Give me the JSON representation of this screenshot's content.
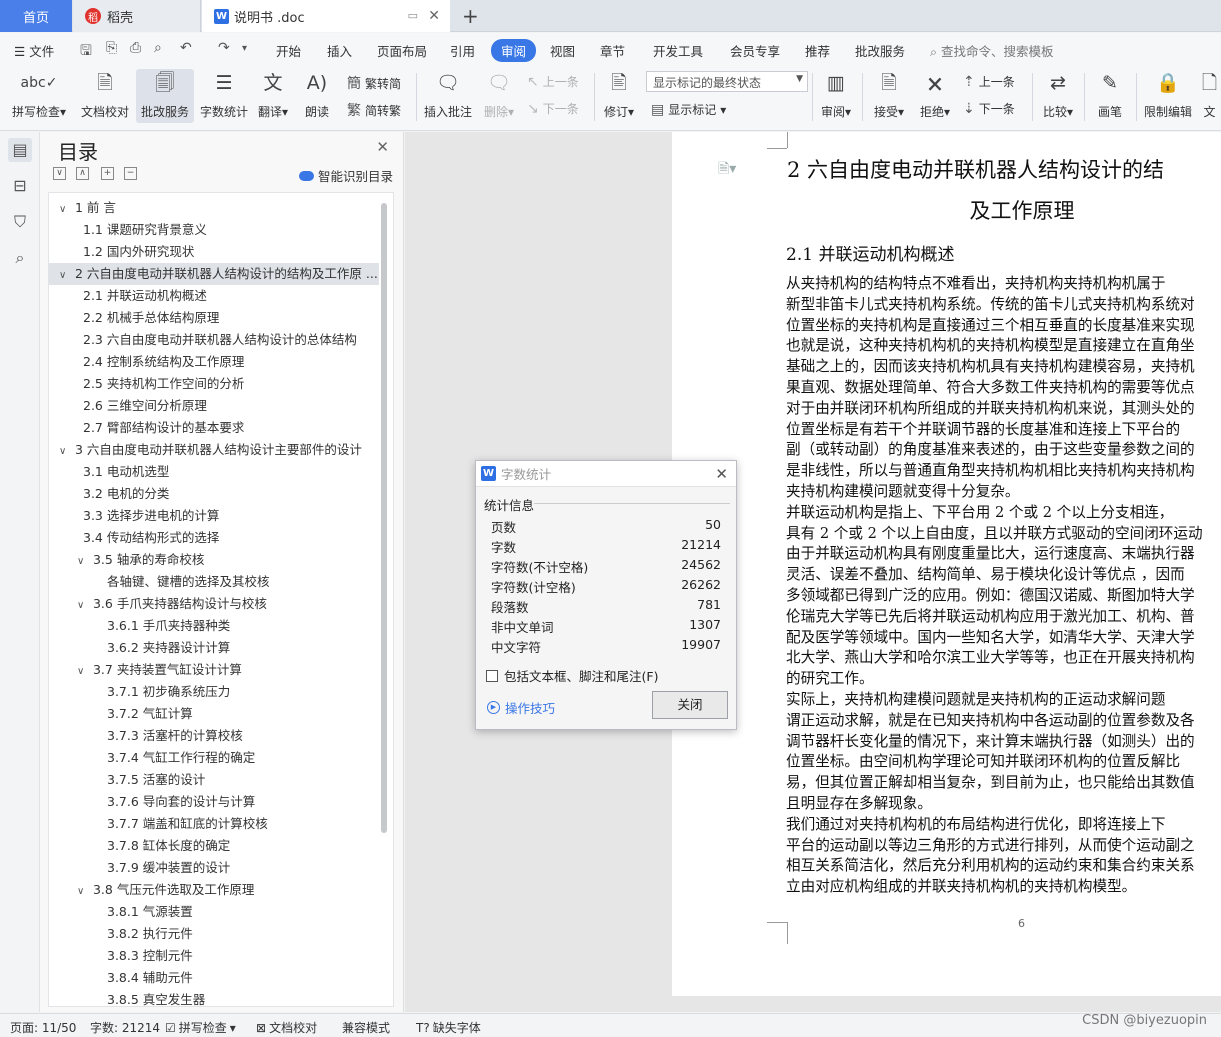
{
  "tabs": {
    "home": "首页",
    "daoke": "稻壳",
    "doc": "说明书 .doc",
    "add": "+"
  },
  "menu": {
    "file": "文件",
    "items": [
      "开始",
      "插入",
      "页面布局",
      "引用",
      "审阅",
      "视图",
      "章节",
      "开发工具",
      "会员专享",
      "推荐",
      "批改服务"
    ],
    "active": "审阅",
    "search_placeholder": "查找命令、搜索模板"
  },
  "ribbon": {
    "spell_check": "拼写检查",
    "doc_check": "文档校对",
    "review_service": "批改服务",
    "word_count": "字数统计",
    "translate": "翻译",
    "read_aloud": "朗读",
    "to_traditional": "繁转简",
    "to_simplified": "简转繁",
    "insert_comment": "插入批注",
    "delete": "删除",
    "prev": "上一条",
    "next": "下一条",
    "track_changes": "修订",
    "markup_state": "显示标记的最终状态",
    "show_markup": "显示标记",
    "review": "审阅",
    "accept": "接受",
    "reject": "拒绝",
    "prev2": "上一条",
    "next2": "下一条",
    "compare": "比较",
    "pen": "画笔",
    "restrict_edit": "限制编辑",
    "doc_cut": "文"
  },
  "toc": {
    "title": "目录",
    "smart_toc": "智能识别目录",
    "items": [
      {
        "level": 1,
        "toggle": "∨",
        "text": "1   前 言"
      },
      {
        "level": 2,
        "toggle": "",
        "text": "1.1  课题研究背景意义"
      },
      {
        "level": 2,
        "toggle": "",
        "text": "1.2  国内外研究现状"
      },
      {
        "level": 1,
        "toggle": "∨",
        "text": "2    六自由度电动并联机器人结构设计的结构及工作原 ...",
        "selected": true
      },
      {
        "level": 2,
        "toggle": "",
        "text": "2.1  并联运动机构概述"
      },
      {
        "level": 2,
        "toggle": "",
        "text": "2.2  机械手总体结构原理"
      },
      {
        "level": 2,
        "toggle": "",
        "text": "2.3 六自由度电动并联机器人结构设计的总体结构"
      },
      {
        "level": 2,
        "toggle": "",
        "text": "2.4  控制系统结构及工作原理"
      },
      {
        "level": 2,
        "toggle": "",
        "text": "2.5  夹持机构工作空间的分析"
      },
      {
        "level": 2,
        "toggle": "",
        "text": "2.6 三维空间分析原理"
      },
      {
        "level": 2,
        "toggle": "",
        "text": "2.7  臂部结构设计的基本要求"
      },
      {
        "level": 1,
        "toggle": "∨",
        "text": "3    六自由度电动并联机器人结构设计主要部件的设计"
      },
      {
        "level": 2,
        "toggle": "",
        "text": "3.1  电动机选型"
      },
      {
        "level": 2,
        "toggle": "",
        "text": "3.2 电机的分类"
      },
      {
        "level": 2,
        "toggle": "",
        "text": "3.3 选择步进电机的计算"
      },
      {
        "level": 2,
        "toggle": "",
        "text": "3.4 传动结构形式的选择"
      },
      {
        "level": 2,
        "toggle": "∨",
        "text": "3.5  轴承的寿命校核"
      },
      {
        "level": 3,
        "toggle": "",
        "text": "各轴键、键槽的选择及其校核"
      },
      {
        "level": 2,
        "toggle": "∨",
        "text": "3.6  手爪夹持器结构设计与校核"
      },
      {
        "level": 3,
        "toggle": "",
        "text": "3.6.1 手爪夹持器种类"
      },
      {
        "level": 3,
        "toggle": "",
        "text": "3.6.2 夹持器设计计算"
      },
      {
        "level": 2,
        "toggle": "∨",
        "text": "3.7  夹持装置气缸设计计算"
      },
      {
        "level": 3,
        "toggle": "",
        "text": "3.7.1  初步确系统压力"
      },
      {
        "level": 3,
        "toggle": "",
        "text": "3.7.2 气缸计算"
      },
      {
        "level": 3,
        "toggle": "",
        "text": "3.7.3  活塞杆的计算校核"
      },
      {
        "level": 3,
        "toggle": "",
        "text": "3.7.4  气缸工作行程的确定"
      },
      {
        "level": 3,
        "toggle": "",
        "text": "3.7.5  活塞的设计"
      },
      {
        "level": 3,
        "toggle": "",
        "text": "3.7.6  导向套的设计与计算"
      },
      {
        "level": 3,
        "toggle": "",
        "text": "3.7.7  端盖和缸底的计算校核"
      },
      {
        "level": 3,
        "toggle": "",
        "text": "3.7.8  缸体长度的确定"
      },
      {
        "level": 3,
        "toggle": "",
        "text": "3.7.9  缓冲装置的设计"
      },
      {
        "level": 2,
        "toggle": "∨",
        "text": "3.8  气压元件选取及工作原理"
      },
      {
        "level": 3,
        "toggle": "",
        "text": "3.8.1  气源装置"
      },
      {
        "level": 3,
        "toggle": "",
        "text": "3.8.2  执行元件"
      },
      {
        "level": 3,
        "toggle": "",
        "text": "3.8.3  控制元件"
      },
      {
        "level": 3,
        "toggle": "",
        "text": "3.8.4  辅助元件"
      },
      {
        "level": 3,
        "toggle": "",
        "text": "3.8.5  真空发生器"
      }
    ]
  },
  "document": {
    "chapter_title_line1": "2    六自由度电动并联机器人结构设计的结",
    "chapter_title_line2": "及工作原理",
    "section_title": "2.1  并联运动机构概述",
    "lines": [
      "      从夹持机构的结构特点不难看出，夹持机构夹持机构机属于",
      "新型非笛卡儿式夹持机构系统。传统的笛卡儿式夹持机构系统对",
      "位置坐标的夹持机构是直接通过三个相互垂直的长度基准来实现",
      "也就是说，这种夹持机构机的夹持机构模型是直接建立在直角坐",
      "基础之上的，因而该夹持机构机具有夹持机构建模容易，夹持机",
      "果直观、数据处理简单、符合大多数工件夹持机构的需要等优点",
      "对于由并联闭环机构所组成的并联夹持机构机来说，其测头处的",
      "位置坐标是有若干个并联调节器的长度基准和连接上下平台的",
      "副（或转动副）的角度基准来表述的，由于这些变量参数之间的",
      "是非线性，所以与普通直角型夹持机构机相比夹持机构夹持机构",
      "夹持机构建模问题就变得十分复杂。",
      "      并联运动机构是指上、下平台用 2 个或 2 个以上分支相连，",
      "具有 2 个或 2 个以上自由度，且以并联方式驱动的空间闭环运动",
      "由于并联运动机构具有刚度重量比大，运行速度高、末端执行器",
      "灵活、误差不叠加、结构简单、易于模块化设计等优点 ，因而",
      "多领域都已得到广泛的应用。例如：德国汉诺威、斯图加特大学",
      "伦瑞克大学等已先后将并联运动机构应用于激光加工、机构、普",
      "配及医学等领域中。国内一些知名大学，如清华大学、天津大学",
      "北大学、燕山大学和哈尔滨工业大学等等，也正在开展夹持机构",
      "的研究工作。",
      "      实际上，夹持机构建模问题就是夹持机构的正运动求解问题",
      "谓正运动求解，就是在已知夹持机构中各运动副的位置参数及各",
      "调节器杆长变化量的情况下，来计算末端执行器（如测头）出的",
      "位置坐标。由空间机构学理论可知并联闭环机构的位置反解比",
      "易，但其位置正解却相当复杂，到目前为止，也只能给出其数值",
      "且明显存在多解现象。",
      "      我们通过对夹持机构机的布局结构进行优化，即将连接上下",
      "平台的运动副以等边三角形的方式进行排列，从而使个运动副之",
      "相互关系简洁化，然后充分利用机构的运动约束和集合约束关系",
      "立由对应机构组成的并联夹持机构机的夹持机构模型。"
    ],
    "page_number": "6"
  },
  "dialog": {
    "title": "字数统计",
    "group": "统计信息",
    "stats": [
      {
        "label": "页数",
        "value": "50"
      },
      {
        "label": "字数",
        "value": "21214"
      },
      {
        "label": "字符数(不计空格)",
        "value": "24562"
      },
      {
        "label": "字符数(计空格)",
        "value": "26262"
      },
      {
        "label": "段落数",
        "value": "781"
      },
      {
        "label": "非中文单词",
        "value": "1307"
      },
      {
        "label": "中文字符",
        "value": "19907"
      }
    ],
    "checkbox_label": "包括文本框、脚注和尾注(F)",
    "tips": "操作技巧",
    "close": "关闭"
  },
  "status": {
    "page": "页面: 11/50",
    "words": "字数: 21214",
    "spell": "拼写检查",
    "doc_check": "文档校对",
    "compat": "兼容模式",
    "missing_font": "缺失字体"
  },
  "watermark": "CSDN @biyezuopin",
  "colors": {
    "accent": "#3a77e6",
    "home_tab": "#4a7ee8"
  }
}
